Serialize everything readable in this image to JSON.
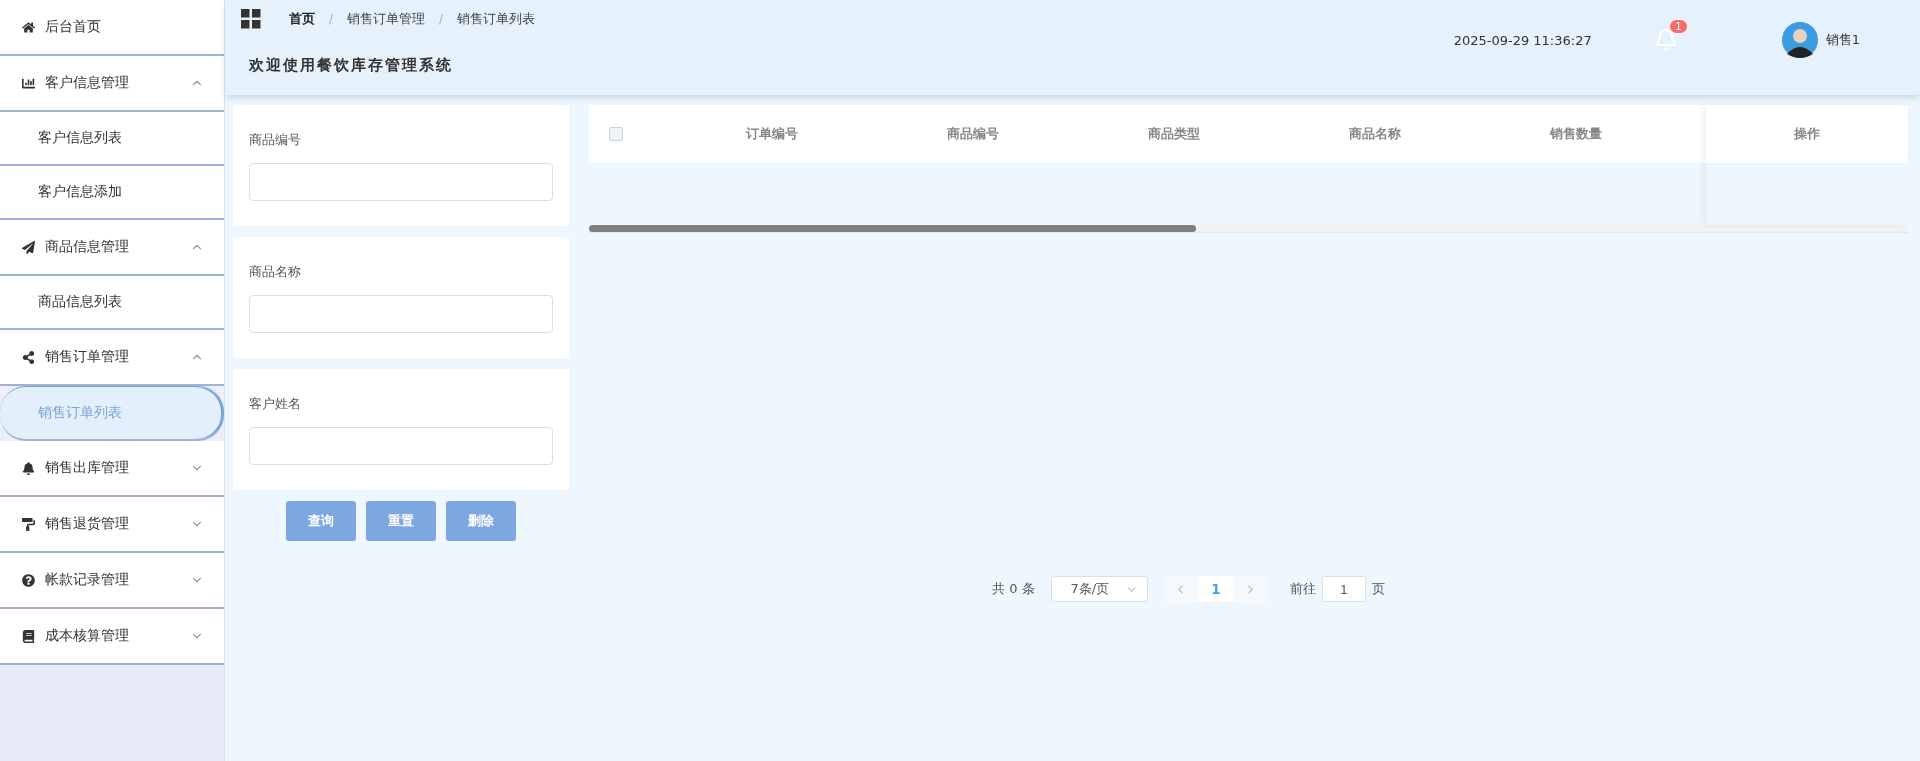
{
  "sidebar": {
    "items": [
      {
        "kind": "link",
        "label": "后台首页"
      },
      {
        "kind": "group",
        "label": "客户信息管理",
        "expanded": true,
        "children": [
          {
            "label": "客户信息列表",
            "selected": false
          },
          {
            "label": "客户信息添加",
            "selected": false
          }
        ]
      },
      {
        "kind": "group",
        "label": "商品信息管理",
        "expanded": true,
        "children": [
          {
            "label": "商品信息列表",
            "selected": false
          }
        ]
      },
      {
        "kind": "group",
        "label": "销售订单管理",
        "expanded": true,
        "children": [
          {
            "label": "销售订单列表",
            "selected": true
          }
        ]
      },
      {
        "kind": "group",
        "label": "销售出库管理",
        "expanded": false
      },
      {
        "kind": "group",
        "label": "销售退货管理",
        "expanded": false
      },
      {
        "kind": "group",
        "label": "帐款记录管理",
        "expanded": false
      },
      {
        "kind": "group",
        "label": "成本核算管理",
        "expanded": false
      }
    ]
  },
  "header": {
    "breadcrumb": [
      "首页",
      "销售订单管理",
      "销售订单列表"
    ],
    "breadcrumb_separator": "/",
    "welcome": "欢迎使用餐饮库存管理系统",
    "datetime": "2025-09-29 11:36:27",
    "notifications": "1",
    "user": "销售1"
  },
  "filters": [
    {
      "label": "商品编号"
    },
    {
      "label": "商品名称"
    },
    {
      "label": "客户姓名"
    }
  ],
  "actions": [
    "查询",
    "重置",
    "删除"
  ],
  "table": {
    "select_all_checked": false,
    "columns": [
      "订单编号",
      "商品编号",
      "商品类型",
      "商品名称",
      "销售数量"
    ],
    "fixed_column": "操作"
  },
  "pagination": {
    "total": "共 0 条",
    "page_size": "7条/页",
    "pages": [
      {
        "label": "1",
        "selected": true
      }
    ],
    "goto_label": "前往",
    "goto_value": "1",
    "goto_suffix": "页"
  }
}
